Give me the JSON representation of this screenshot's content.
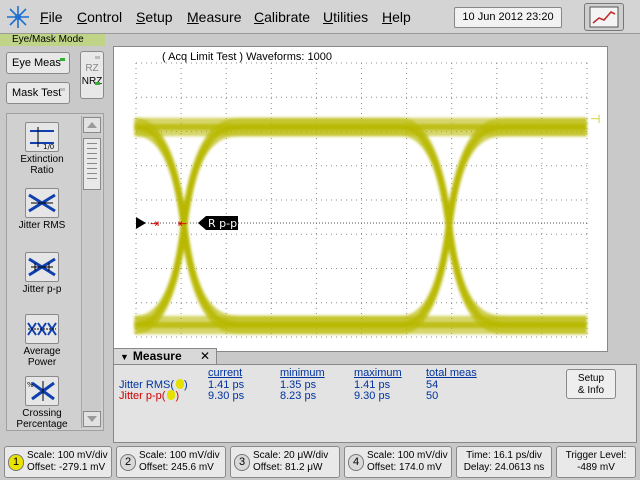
{
  "menu": {
    "items": [
      {
        "key": "F",
        "rest": "ile"
      },
      {
        "key": "C",
        "rest": "ontrol"
      },
      {
        "key": "S",
        "rest": "etup"
      },
      {
        "key": "M",
        "rest": "easure"
      },
      {
        "key": "C",
        "rest": "alibrate"
      },
      {
        "key": "U",
        "rest": "tilities"
      },
      {
        "key": "H",
        "rest": "elp"
      }
    ],
    "datetime": "10 Jun 2012   23:20"
  },
  "left_panel": {
    "mode_label": "Eye/Mask Mode",
    "eye_meas": "Eye Meas",
    "mask_test": "Mask Test",
    "rz": "RZ",
    "nrz": "NRZ",
    "tools": [
      {
        "line1": "Extinction",
        "line2": "Ratio",
        "icon": "extinction-ratio-icon"
      },
      {
        "line1": "Jitter RMS",
        "line2": "",
        "icon": "jitter-rms-icon"
      },
      {
        "line1": "Jitter p-p",
        "line2": "",
        "icon": "jitter-pp-icon"
      },
      {
        "line1": "Average",
        "line2": "Power",
        "icon": "average-power-icon"
      },
      {
        "line1": "Crossing",
        "line2": "Percentage",
        "icon": "crossing-percentage-icon"
      }
    ]
  },
  "graticule": {
    "acq_status": "( Acq Limit Test )  Waveforms: 1000",
    "marker_label": "R p-p",
    "trace_color": "#b8b800"
  },
  "measure": {
    "title": "Measure",
    "columns": [
      "current",
      "minimum",
      "maximum",
      "total meas"
    ],
    "rows": [
      {
        "label": "Jitter RMS(",
        "color": "#0033a0",
        "current": "1.41 ps",
        "minimum": "1.35 ps",
        "maximum": "1.41 ps",
        "total": "54"
      },
      {
        "label": "Jitter p-p(",
        "color": "#d00000",
        "current": "9.30 ps",
        "minimum": "8.23 ps",
        "maximum": "9.30 ps",
        "total": "50"
      }
    ],
    "setup_line1": "Setup",
    "setup_line2": "& Info"
  },
  "channels": [
    {
      "num": "1",
      "scale": "Scale: 100 mV/div",
      "offset": "Offset: -279.1 mV"
    },
    {
      "num": "2",
      "scale": "Scale: 100 mV/div",
      "offset": "Offset: 245.6 mV"
    },
    {
      "num": "3",
      "scale": "Scale: 20 μW/div",
      "offset": "Offset: 81.2 μW"
    },
    {
      "num": "4",
      "scale": "Scale: 100 mV/div",
      "offset": "Offset: 174.0 mV"
    }
  ],
  "timebase": {
    "time": "Time: 16.1 ps/div",
    "delay": "Delay: 24.0613 ns"
  },
  "trigger": {
    "label": "Trigger Level:",
    "value": "-489 mV"
  }
}
